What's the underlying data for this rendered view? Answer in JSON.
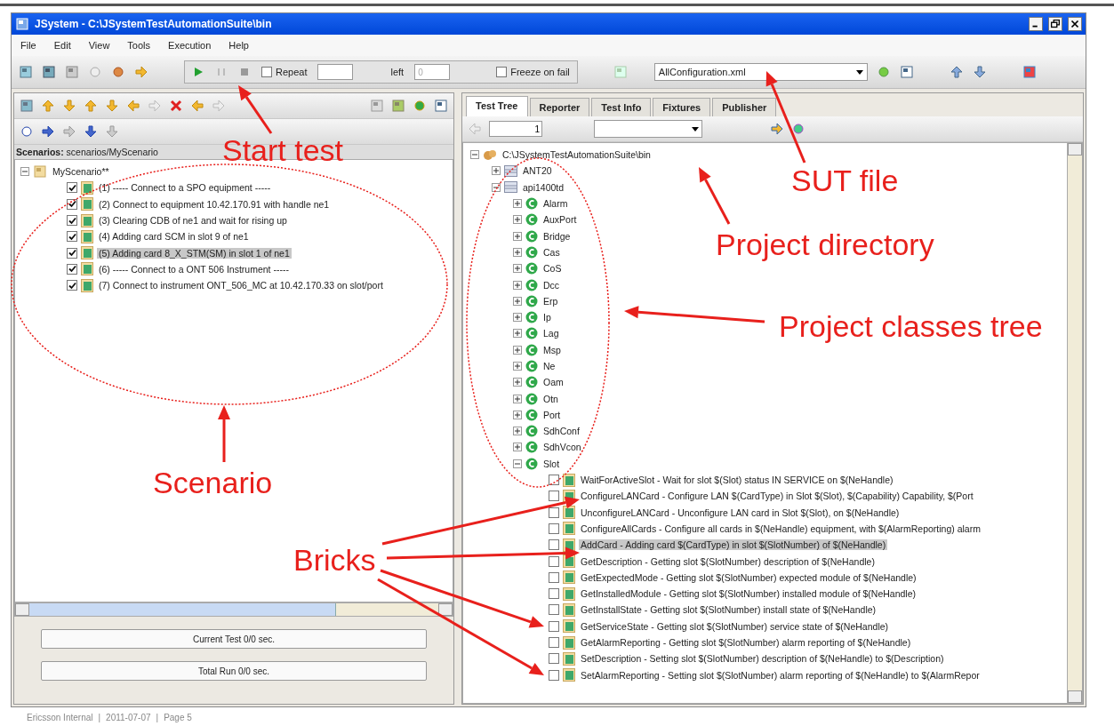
{
  "window": {
    "title": "JSystem - C:\\JSystemTestAutomationSuite\\bin"
  },
  "menu": [
    {
      "label": "File"
    },
    {
      "label": "Edit"
    },
    {
      "label": "View"
    },
    {
      "label": "Tools"
    },
    {
      "label": "Execution"
    },
    {
      "label": "Help"
    }
  ],
  "toolbar": {
    "repeat": {
      "label": "Repeat",
      "checked": false
    },
    "left_label": "left",
    "left_field": {
      "placeholder": "0"
    },
    "freeze": {
      "label": "Freeze on fail",
      "checked": false
    },
    "sut_dropdown": {
      "value": "AllConfiguration.xml"
    }
  },
  "left_panel": {
    "scenario_label": "**Scenarios:** scenarios/MyScenario",
    "tree": {
      "text": "MyScenario**",
      "expanded": true,
      "children": [
        {
          "text": "(1) ----- Connect to a SPO equipment -----",
          "checked": true,
          "selected": false
        },
        {
          "text": "(2) Connect to equipment 10.42.170.91 with handle ne1",
          "checked": true,
          "selected": false
        },
        {
          "text": "(3) Clearing CDB of ne1 and wait for rising up",
          "checked": true,
          "selected": false
        },
        {
          "text": "(4) Adding card SCM in slot 9 of ne1",
          "checked": true,
          "selected": false
        },
        {
          "text": "(5) Adding card 8_X_STM(SM) in slot 1 of ne1",
          "checked": true,
          "selected": true
        },
        {
          "text": "(6) ----- Connect to a ONT 506 Instrument -----",
          "checked": true,
          "selected": false
        },
        {
          "text": "(7) Connect to instrument ONT_506_MC at 10.42.170.33 on slot/port",
          "checked": true,
          "selected": false
        }
      ]
    },
    "progress": [
      "Current Test 0/0 sec.",
      "Total Run 0/0 sec."
    ]
  },
  "right_panel": {
    "tabs": [
      {
        "label": "Test Tree",
        "selected": true
      },
      {
        "label": "Reporter",
        "selected": false
      },
      {
        "label": "Test Info",
        "selected": false
      },
      {
        "label": "Fixtures",
        "selected": false
      },
      {
        "label": "Publisher",
        "selected": false
      }
    ],
    "page_field": {
      "value": "1"
    },
    "tree": {
      "kind": "root",
      "text": "C:\\JSystemTestAutomationSuite\\bin",
      "expanded": true,
      "children": [
        {
          "kind": "package",
          "text": "ANT20",
          "expanded": false
        },
        {
          "kind": "package",
          "text": "api1400td",
          "expanded": true,
          "children": [
            {
              "kind": "class",
              "text": "Alarm",
              "expanded": false
            },
            {
              "kind": "class",
              "text": "AuxPort",
              "expanded": false
            },
            {
              "kind": "class",
              "text": "Bridge",
              "expanded": false
            },
            {
              "kind": "class",
              "text": "Cas",
              "expanded": false
            },
            {
              "kind": "class",
              "text": "CoS",
              "expanded": false
            },
            {
              "kind": "class",
              "text": "Dcc",
              "expanded": false
            },
            {
              "kind": "class",
              "text": "Erp",
              "expanded": false
            },
            {
              "kind": "class",
              "text": "Ip",
              "expanded": false
            },
            {
              "kind": "class",
              "text": "Lag",
              "expanded": false
            },
            {
              "kind": "class",
              "text": "Msp",
              "expanded": false
            },
            {
              "kind": "class",
              "text": "Ne",
              "expanded": false
            },
            {
              "kind": "class",
              "text": "Oam",
              "expanded": false
            },
            {
              "kind": "class",
              "text": "Otn",
              "expanded": false
            },
            {
              "kind": "class",
              "text": "Port",
              "expanded": false
            },
            {
              "kind": "class",
              "text": "SdhConf",
              "expanded": false
            },
            {
              "kind": "class",
              "text": "SdhVcon",
              "expanded": false
            },
            {
              "kind": "class",
              "text": "Slot",
              "expanded": true,
              "children": [
                {
                  "kind": "brick",
                  "text": "WaitForActiveSlot - Wait for slot $(Slot) status IN SERVICE on $(NeHandle)",
                  "checked": false,
                  "selected": false
                },
                {
                  "kind": "brick",
                  "text": "ConfigureLANCard - Configure LAN $(CardType) in Slot $(Slot), $(Capability) Capability, $(Port",
                  "checked": false,
                  "selected": false
                },
                {
                  "kind": "brick",
                  "text": "UnconfigureLANCard - Unconfigure LAN card in Slot $(Slot), on $(NeHandle)",
                  "checked": false,
                  "selected": false
                },
                {
                  "kind": "brick",
                  "text": "ConfigureAllCards - Configure all cards in $(NeHandle) equipment, with $(AlarmReporting) alarm",
                  "checked": false,
                  "selected": false
                },
                {
                  "kind": "brick",
                  "text": "AddCard - Adding card $(CardType) in slot $(SlotNumber) of $(NeHandle)",
                  "checked": false,
                  "selected": true
                },
                {
                  "kind": "brick",
                  "text": "GetDescription - Getting slot $(SlotNumber) description of $(NeHandle)",
                  "checked": false,
                  "selected": false
                },
                {
                  "kind": "brick",
                  "text": "GetExpectedMode - Getting slot $(SlotNumber) expected module of $(NeHandle)",
                  "checked": false,
                  "selected": false
                },
                {
                  "kind": "brick",
                  "text": "GetInstalledModule - Getting slot $(SlotNumber) installed module of $(NeHandle)",
                  "checked": false,
                  "selected": false
                },
                {
                  "kind": "brick",
                  "text": "GetInstallState - Getting slot $(SlotNumber) install state of $(NeHandle)",
                  "checked": false,
                  "selected": false
                },
                {
                  "kind": "brick",
                  "text": "GetServiceState - Getting slot $(SlotNumber) service state of $(NeHandle)",
                  "checked": false,
                  "selected": false
                },
                {
                  "kind": "brick",
                  "text": "GetAlarmReporting - Getting slot $(SlotNumber) alarm reporting of $(NeHandle)",
                  "checked": false,
                  "selected": false
                },
                {
                  "kind": "brick",
                  "text": "SetDescription - Setting slot $(SlotNumber) description of $(NeHandle) to $(Description)",
                  "checked": false,
                  "selected": false
                },
                {
                  "kind": "brick",
                  "text": "SetAlarmReporting - Setting slot $(SlotNumber) alarm reporting of $(NeHandle) to $(AlarmRepor",
                  "checked": false,
                  "selected": false
                }
              ]
            }
          ]
        }
      ]
    }
  },
  "annotations": [
    {
      "text": "Start test"
    },
    {
      "text": "SUT file"
    },
    {
      "text": "Project directory"
    },
    {
      "text": "Project classes tree"
    },
    {
      "text": "Scenario"
    },
    {
      "text": "Bricks"
    }
  ],
  "footer": [
    "Ericsson Internal",
    "|",
    "2011-07-07",
    "|",
    "Page 5"
  ]
}
